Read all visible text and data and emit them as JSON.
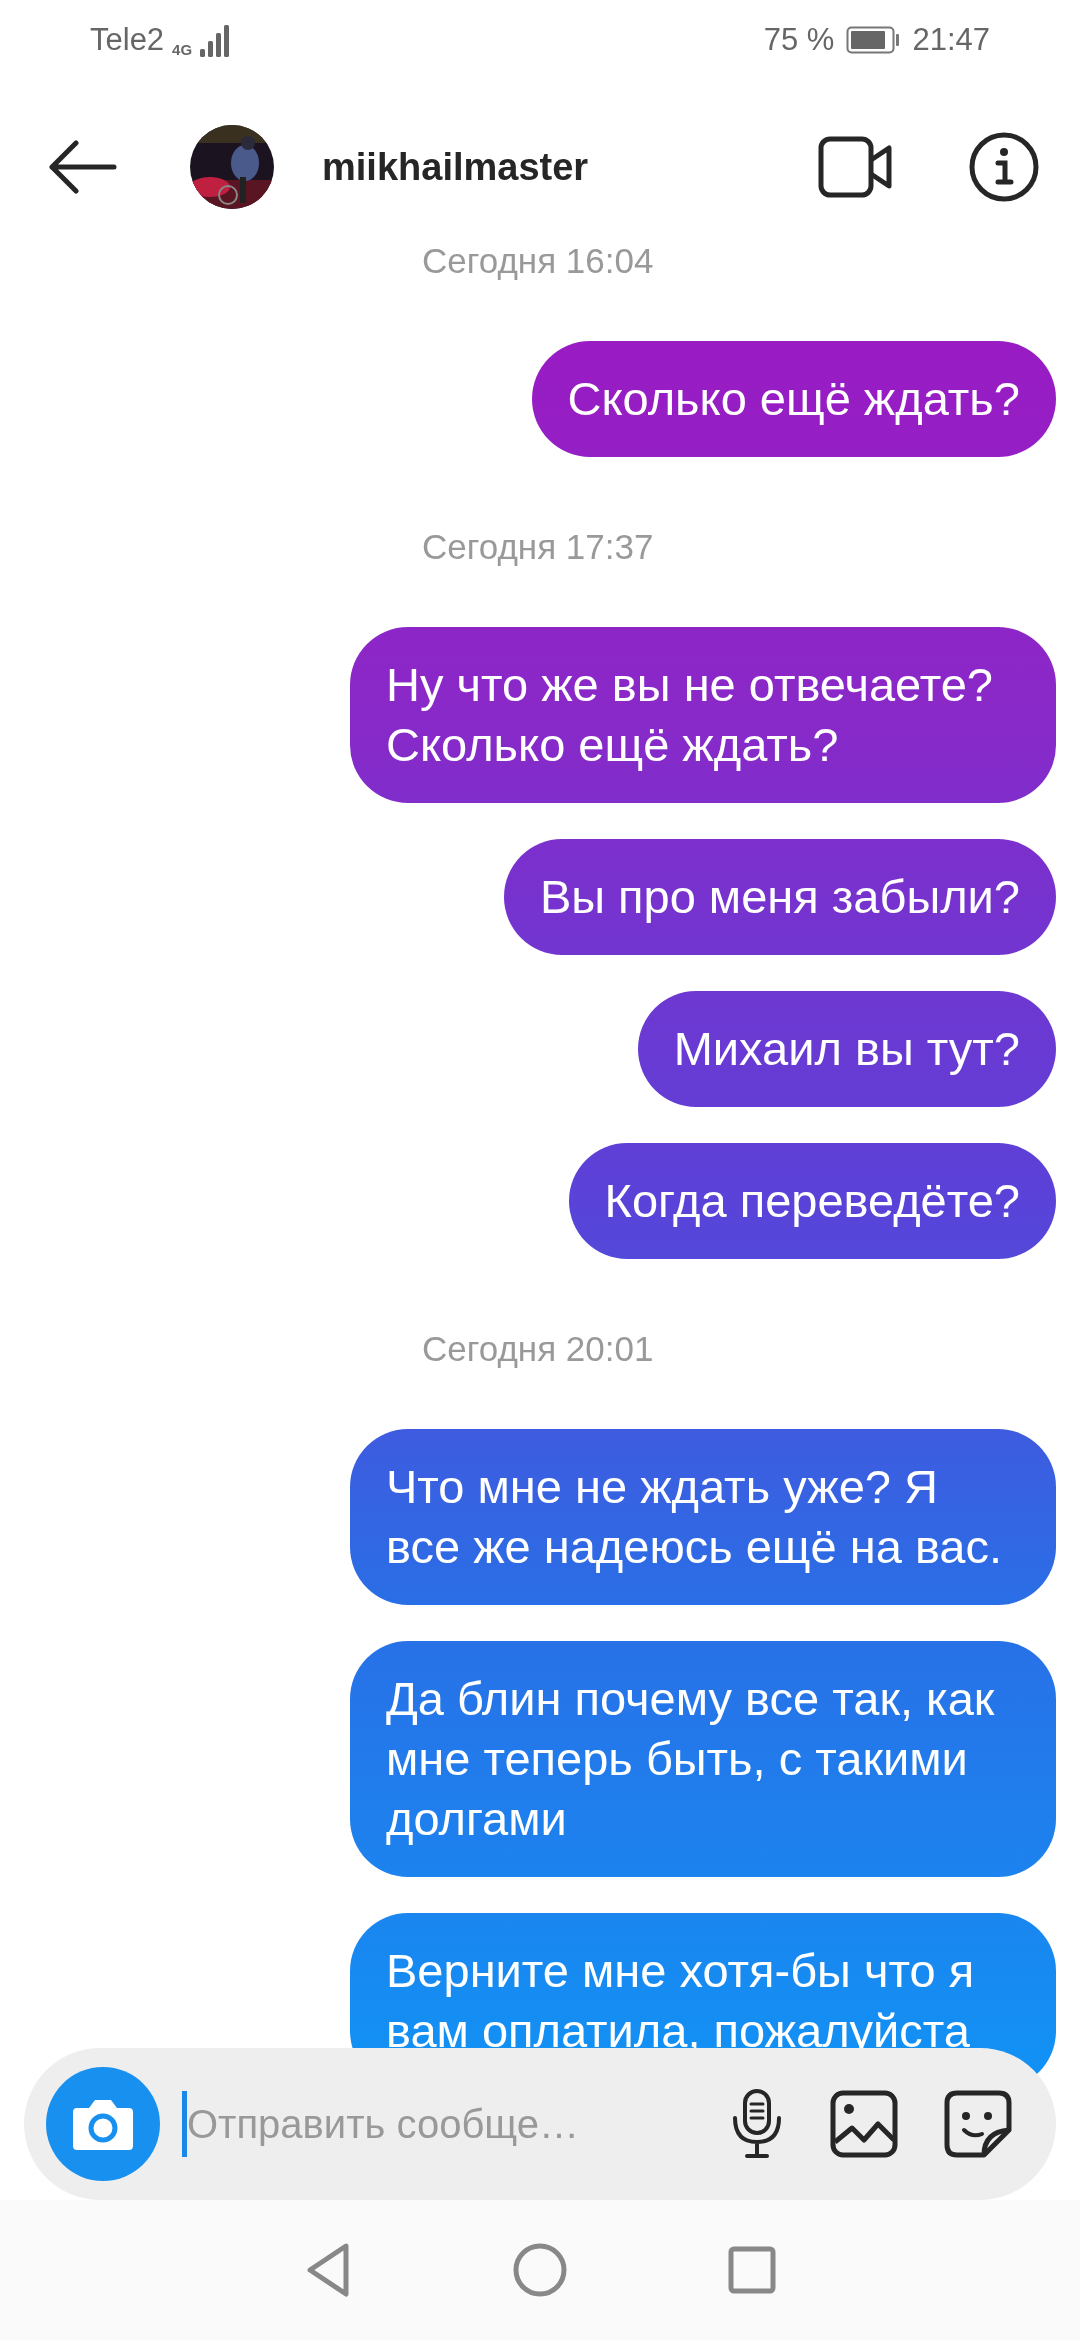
{
  "status_bar": {
    "carrier": "Tele2",
    "network": "4G",
    "battery": "75 %",
    "time": "21:47"
  },
  "header": {
    "username": "miikhailmaster"
  },
  "messages": [
    {
      "kind": "timestamp",
      "text": "Сегодня 16:04"
    },
    {
      "kind": "message",
      "text": "Сколько ещё ждать?"
    },
    {
      "kind": "timestamp",
      "text": "Сегодня 17:37"
    },
    {
      "kind": "message",
      "text": "Ну что же вы не отвечаете? Сколько ещё ждать?"
    },
    {
      "kind": "message",
      "text": "Вы про меня забыли?"
    },
    {
      "kind": "message",
      "text": "Михаил вы тут?"
    },
    {
      "kind": "message",
      "text": "Когда переведёте?"
    },
    {
      "kind": "timestamp",
      "text": "Сегодня 20:01"
    },
    {
      "kind": "message",
      "text": "Что мне не ждать уже? Я все же надеюсь ещё на вас."
    },
    {
      "kind": "message",
      "text": "Да блин почему все так, как мне теперь быть, с такими долгами"
    },
    {
      "kind": "message",
      "text": "Верните мне хотя-бы что я вам оплатила, пожалуйста"
    }
  ],
  "composer": {
    "placeholder": "Отправить сообще…"
  }
}
